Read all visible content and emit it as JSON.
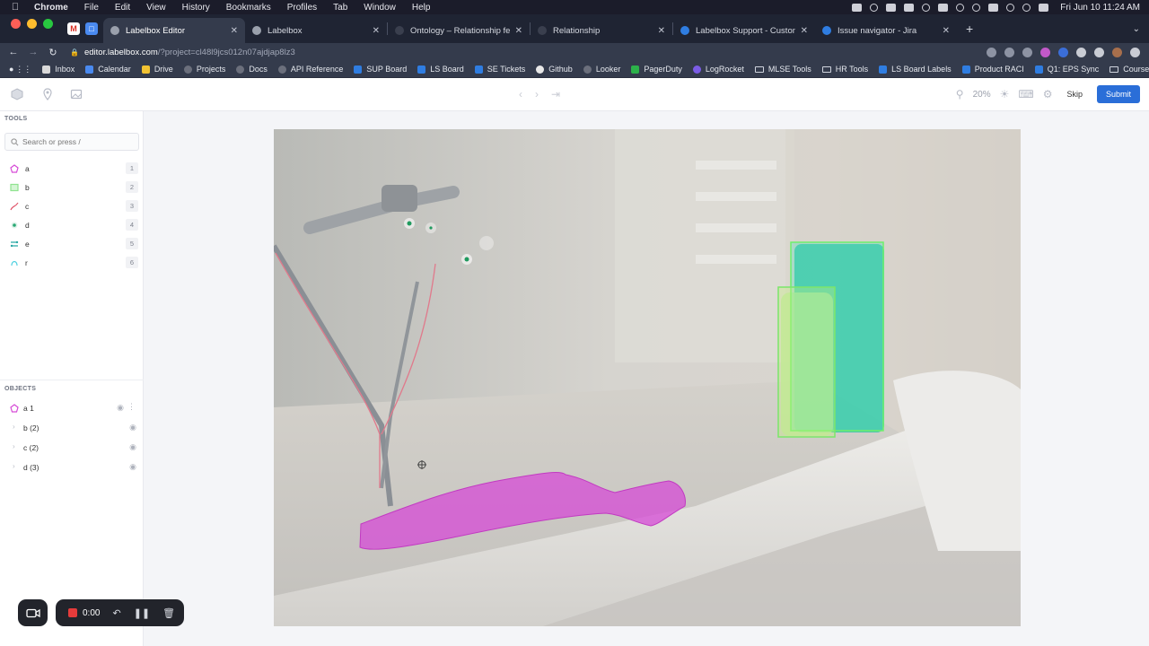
{
  "menubar": {
    "app_name": "Chrome",
    "menus": [
      "File",
      "Edit",
      "View",
      "History",
      "Bookmarks",
      "Profiles",
      "Tab",
      "Window",
      "Help"
    ],
    "clock": "Fri Jun 10  11:24 AM"
  },
  "tabs": [
    {
      "title": "Labelbox Editor",
      "active": true,
      "favicon_color": "#9aa0ac"
    },
    {
      "title": "Labelbox",
      "active": false,
      "favicon_color": "#9aa0ac"
    },
    {
      "title": "Ontology – Relationship featu",
      "active": false,
      "favicon_color": "#3a3f4e"
    },
    {
      "title": "Relationship",
      "active": false,
      "favicon_color": "#3a3f4e"
    },
    {
      "title": "Labelbox Support - Customers",
      "active": false,
      "favicon_color": "#2f7de1"
    },
    {
      "title": "Issue navigator - Jira",
      "active": false,
      "favicon_color": "#2f7de1"
    }
  ],
  "address_bar": {
    "host": "editor.labelbox.com",
    "path": "/?project=cl48l9jcs012n07ajdjap8lz3"
  },
  "bookmarks": [
    {
      "label": "Inbox",
      "color": "#d9d9d9"
    },
    {
      "label": "Calendar",
      "color": "#4a8af0"
    },
    {
      "label": "Drive",
      "color": "#f1c232"
    },
    {
      "label": "Projects",
      "color": "#6b6f7c"
    },
    {
      "label": "Docs",
      "color": "#6b6f7c"
    },
    {
      "label": "API Reference",
      "color": "#6b6f7c"
    },
    {
      "label": "SUP Board",
      "color": "#2f7de1"
    },
    {
      "label": "LS Board",
      "color": "#2f7de1"
    },
    {
      "label": "SE Tickets",
      "color": "#2f7de1"
    },
    {
      "label": "Github",
      "color": "#e8e8e8"
    },
    {
      "label": "Looker",
      "color": "#6b6f7c"
    },
    {
      "label": "PagerDuty",
      "color": "#2cb14a"
    },
    {
      "label": "LogRocket",
      "color": "#7b5ce6"
    },
    {
      "label": "MLSE Tools",
      "color": "folder"
    },
    {
      "label": "HR Tools",
      "color": "folder"
    },
    {
      "label": "LS Board Labels",
      "color": "#2f7de1"
    },
    {
      "label": "Product RACI",
      "color": "#2f7de1"
    },
    {
      "label": "Q1: EPS Sync",
      "color": "#2f7de1"
    },
    {
      "label": "Courses",
      "color": "folder"
    }
  ],
  "toolbar": {
    "zoom": "20%",
    "skip_label": "Skip",
    "submit_label": "Submit",
    "accent": "#2a6ed8"
  },
  "tools_panel": {
    "header": "TOOLS",
    "search_placeholder": "Search or press /",
    "items": [
      {
        "name": "a",
        "hotkey": "1",
        "icon": "polygon-icon",
        "color": "#d64ad6"
      },
      {
        "name": "b",
        "hotkey": "2",
        "icon": "bounding-box-icon",
        "color": "#8fe38f"
      },
      {
        "name": "c",
        "hotkey": "3",
        "icon": "polyline-icon",
        "color": "#e0556a"
      },
      {
        "name": "d",
        "hotkey": "4",
        "icon": "point-icon",
        "color": "#2aa874"
      },
      {
        "name": "e",
        "hotkey": "5",
        "icon": "relationship-icon",
        "color": "#28a7a4"
      },
      {
        "name": "r",
        "hotkey": "6",
        "icon": "relationship-arc-icon",
        "color": "#4fd0e0"
      }
    ]
  },
  "objects_panel": {
    "header": "OBJECTS",
    "items": [
      {
        "label": "a 1",
        "icon": "polygon-icon",
        "color": "#d64ad6"
      },
      {
        "label": "b (2)"
      },
      {
        "label": "c (2)"
      },
      {
        "label": "d (3)"
      }
    ]
  },
  "recording": {
    "timer": "0:00"
  }
}
